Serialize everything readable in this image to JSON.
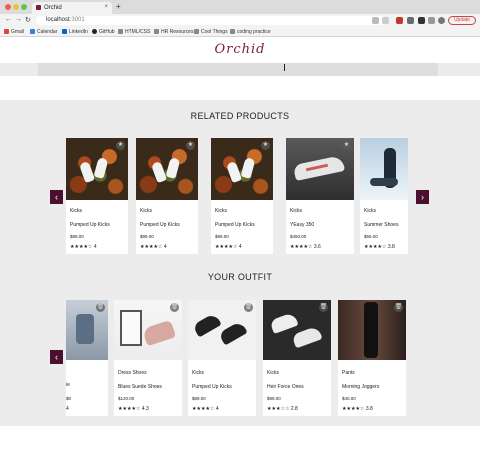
{
  "browser": {
    "tab_title": "Orchid",
    "tab_close": "×",
    "new_tab": "+",
    "url_host": "localhost",
    "url_port": ":3001",
    "update_label": "Update",
    "bookmarks": [
      "Gmail",
      "Calendar",
      "LinkedIn",
      "GitHub",
      "HTML/CSS",
      "HR Resources",
      "Cool Things",
      "coding practice"
    ]
  },
  "header": {
    "logo": "Orchid"
  },
  "related": {
    "title": "RELATED PRODUCTS",
    "prev": "‹",
    "next": "›",
    "items": [
      {
        "category": "Kicks",
        "name": "Pumped Up Kicks",
        "price": "$89.00",
        "stars": "★★★★☆",
        "rating": "4"
      },
      {
        "category": "Kicks",
        "name": "Pumped Up Kicks",
        "price": "$89.00",
        "stars": "★★★★☆",
        "rating": "4"
      },
      {
        "category": "Kicks",
        "name": "Pumped Up Kicks",
        "price": "$89.00",
        "stars": "★★★★☆",
        "rating": "4"
      },
      {
        "category": "Kicks",
        "name": "YEasy 350",
        "price": "$450.00",
        "stars": "★★★★☆",
        "rating": "3.6"
      },
      {
        "category": "Kicks",
        "name": "Summer Shoes",
        "price": "$59.00",
        "stars": "★★★★☆",
        "rating": "3.8"
      }
    ]
  },
  "outfit": {
    "title": "YOUR OUTFIT",
    "prev": "‹",
    "items": [
      {
        "category": "",
        "name": "ie",
        "price": "$0",
        "stars": "",
        "rating": "4"
      },
      {
        "category": "Dress Shoes",
        "name": "Blues Suede Shoes",
        "price": "$120.00",
        "stars": "★★★★☆",
        "rating": "4.3"
      },
      {
        "category": "Kicks",
        "name": "Pumped Up Kicks",
        "price": "$89.00",
        "stars": "★★★★☆",
        "rating": "4"
      },
      {
        "category": "Kicks",
        "name": "Heir Force Ones",
        "price": "$99.00",
        "stars": "★★★☆☆",
        "rating": "2.8"
      },
      {
        "category": "Pants",
        "name": "Morning Joggers",
        "price": "$40.00",
        "stars": "★★★★☆",
        "rating": "3.8"
      }
    ]
  },
  "icons": {
    "star_badge": "★",
    "delete_badge": "🗑"
  }
}
